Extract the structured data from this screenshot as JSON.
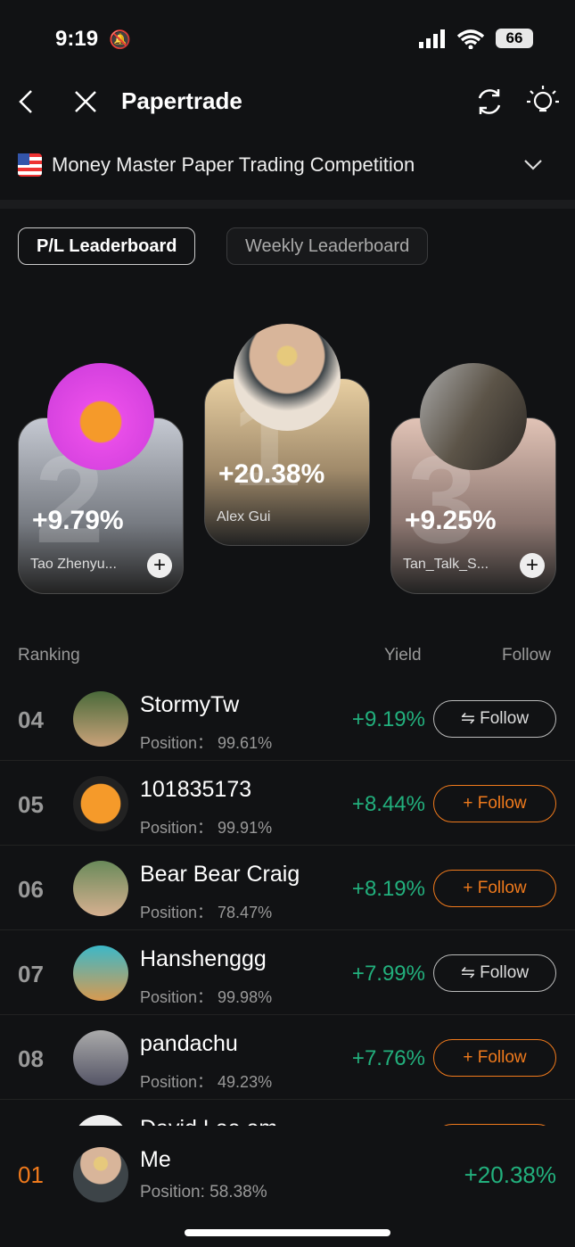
{
  "status": {
    "time": "9:19",
    "battery": "66"
  },
  "header": {
    "title": "Papertrade"
  },
  "competition": {
    "name": "Money Master Paper Trading Competition"
  },
  "tabs": [
    {
      "label": "P/L Leaderboard",
      "active": true
    },
    {
      "label": "Weekly Leaderboard",
      "active": false
    }
  ],
  "podium": [
    {
      "rank": "2",
      "yield": "+9.79%",
      "name": "Tao Zhenyu..."
    },
    {
      "rank": "1",
      "yield": "+20.38%",
      "name": "Alex Gui"
    },
    {
      "rank": "3",
      "yield": "+9.25%",
      "name": "Tan_Talk_S..."
    }
  ],
  "table_header": {
    "ranking": "Ranking",
    "yield": "Yield",
    "follow": "Follow"
  },
  "rows": [
    {
      "rank": "04",
      "name": "StormyTw",
      "position": "Position：  99.61%",
      "yield": "+9.19%",
      "follow": "⇋ Follow",
      "state": "following"
    },
    {
      "rank": "05",
      "name": "101835173",
      "position": "Position：  99.91%",
      "yield": "+8.44%",
      "follow": "+ Follow",
      "state": "follow"
    },
    {
      "rank": "06",
      "name": "Bear Bear Craig",
      "position": "Position：  78.47%",
      "yield": "+8.19%",
      "follow": "+ Follow",
      "state": "follow"
    },
    {
      "rank": "07",
      "name": "Hanshenggg",
      "position": "Position：  99.98%",
      "yield": "+7.99%",
      "follow": "⇋ Follow",
      "state": "following"
    },
    {
      "rank": "08",
      "name": "pandachu",
      "position": "Position：  49.23%",
      "yield": "+7.76%",
      "follow": "+ Follow",
      "state": "follow"
    },
    {
      "rank": "",
      "name": "David Lee.em",
      "position": "",
      "yield": "",
      "follow": "",
      "state": "follow"
    }
  ],
  "me": {
    "rank": "01",
    "name": "Me",
    "position": "Position: 58.38%",
    "yield": "+20.38%"
  },
  "colors": {
    "accent": "#f07a1c",
    "positive": "#22b07d",
    "background": "#111214"
  }
}
